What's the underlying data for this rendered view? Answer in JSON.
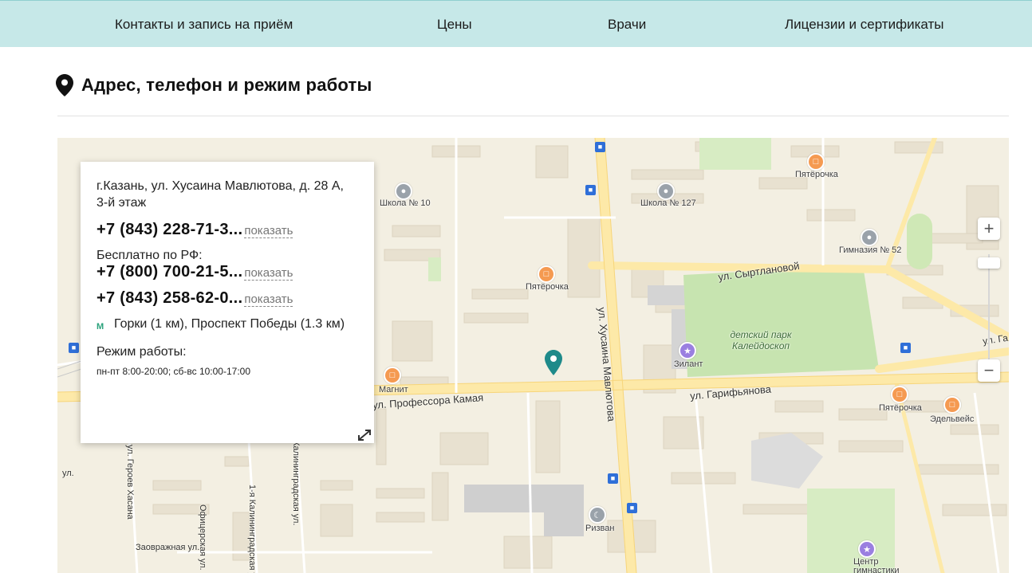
{
  "nav": {
    "items": [
      {
        "label": "Контакты и запись на приём"
      },
      {
        "label": "Цены"
      },
      {
        "label": "Врачи"
      },
      {
        "label": "Лицензии и сертификаты"
      }
    ]
  },
  "section": {
    "title": "Адрес, телефон и режим работы"
  },
  "card": {
    "address": "г.Казань, ул. Хусаина Мавлютова, д. 28 А, 3-й этаж",
    "phone1": "+7 (843) 228-71-3...",
    "free_label": "Бесплатно по РФ:",
    "phone2": "+7 (800) 700-21-5...",
    "phone3": "+7 (843) 258-62-0...",
    "show_label": "показать",
    "metro_icon": "M",
    "metro": "Горки (1 км), Проспект Победы (1.3 км)",
    "hours_label": "Режим работы:",
    "hours": "пн-пт 8:00-20:00; сб-вс 10:00-17:00"
  },
  "map": {
    "streets": {
      "syrtlanovoy": "ул. Сыртлановой",
      "garifyanova": "ул. Гарифьянова",
      "kamaya": "ул. Профессора Камая",
      "mavlyutova": "ул. Хусаина Мавлютова",
      "ofitserskaya": "Офицерская ул.",
      "kaliningradskaya1": "1-я Калининградская ул.",
      "kaliningradskaya": "Калининградская ул.",
      "zovrazhnaya": "Заовражная ул.",
      "geroev": "ул. Героев Хасана",
      "ul_left": "ул.",
      "ul_right": "ул. Га"
    },
    "labels": {
      "school10": "Школа № 10",
      "school127": "Школа № 127",
      "gym52": "Гимназия № 52",
      "pyat1": "Пятёрочка",
      "pyat2": "Пятёрочка",
      "pyat3": "Пятёрочка",
      "magnit": "Магнит",
      "zilant": "Зилант",
      "park": "детский парк Калейдоскоп",
      "edelweiss": "Эдельвейс",
      "rizvan": "Ризван",
      "center": "Центр гимнастики"
    },
    "colors": {
      "marker": "#1e8a8a",
      "park": "#c7e4b0",
      "road": "#fbe7a3",
      "building": "#e6dfcf"
    }
  }
}
